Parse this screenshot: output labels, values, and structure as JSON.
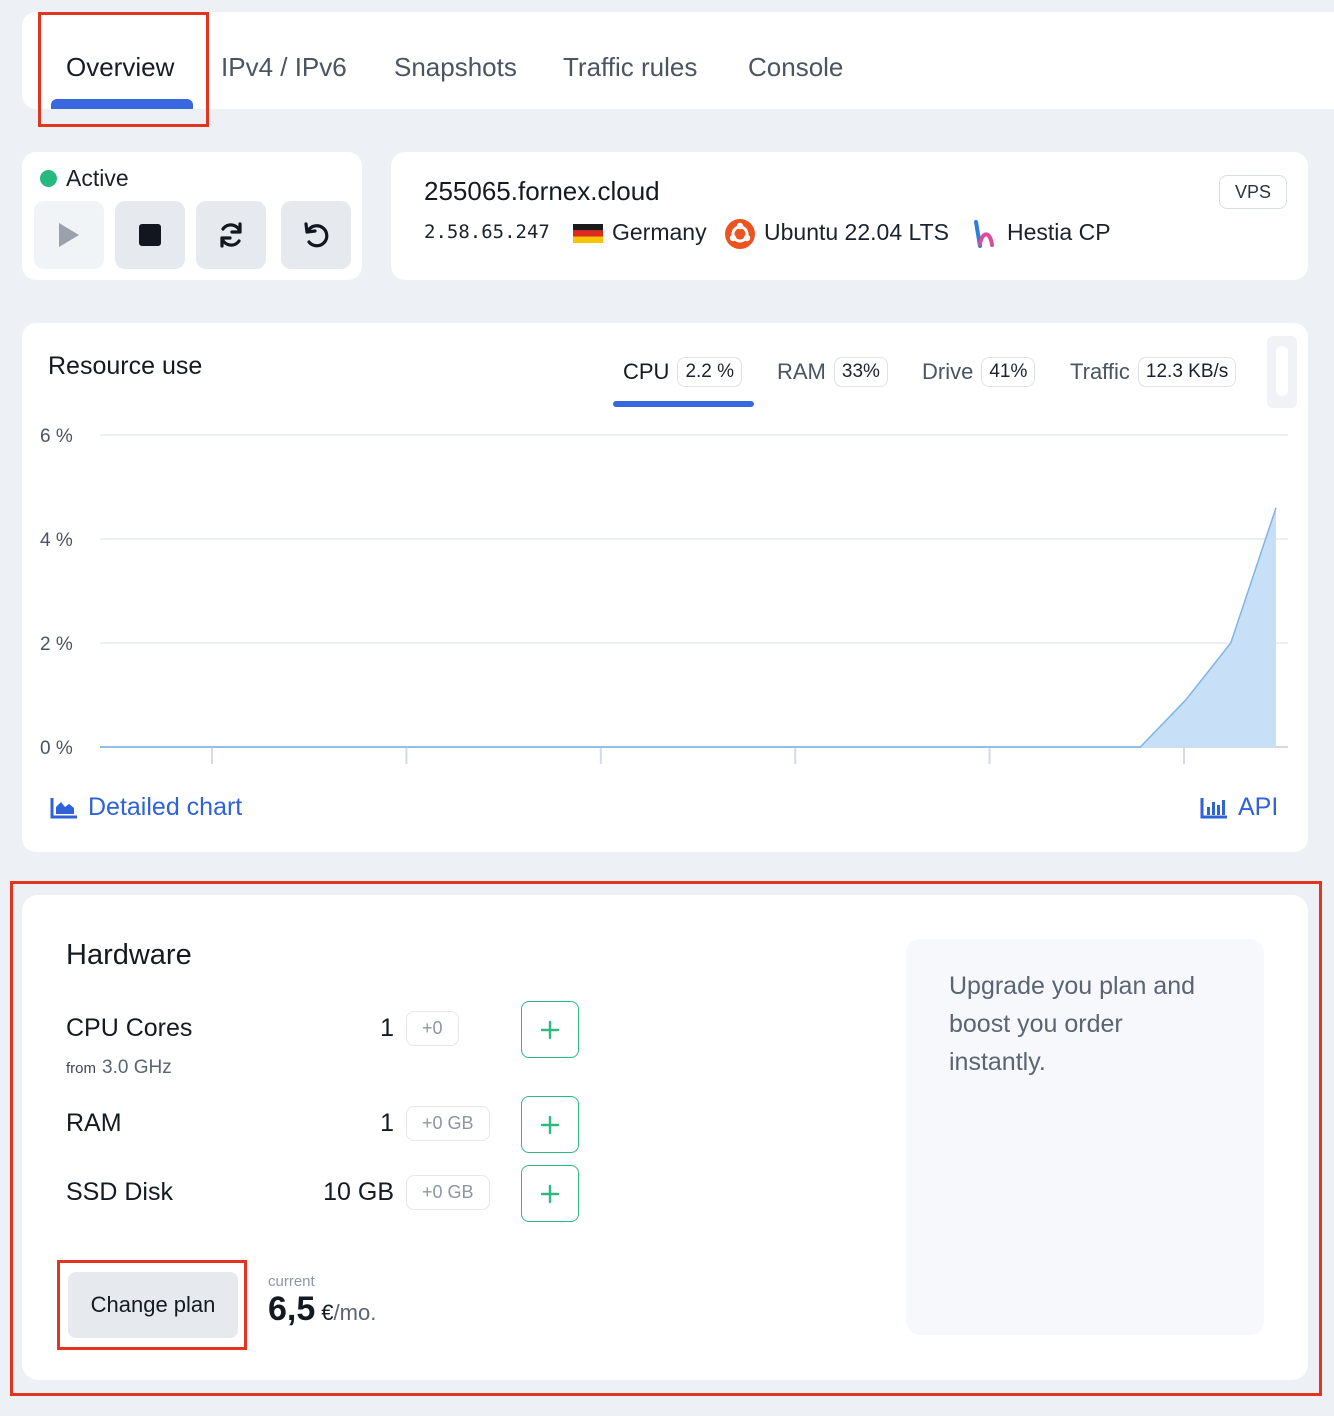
{
  "tabs": [
    {
      "label": "Overview",
      "active": true
    },
    {
      "label": "IPv4 / IPv6",
      "active": false
    },
    {
      "label": "Snapshots",
      "active": false
    },
    {
      "label": "Traffic rules",
      "active": false
    },
    {
      "label": "Console",
      "active": false
    }
  ],
  "status": {
    "label": "Active",
    "color": "#28b981",
    "controls": [
      "play-icon",
      "stop-icon",
      "refresh-icon",
      "reinstall-icon"
    ]
  },
  "server": {
    "hostname": "255065.fornex.cloud",
    "type_badge": "VPS",
    "ip": "2.58.65.247",
    "country": "Germany",
    "os": "Ubuntu 22.04 LTS",
    "panel": "Hestia CP"
  },
  "resources": {
    "title": "Resource use",
    "tabs": [
      {
        "label": "CPU",
        "value": "2.2 %",
        "active": true
      },
      {
        "label": "RAM",
        "value": "33%",
        "active": false
      },
      {
        "label": "Drive",
        "value": "41%",
        "active": false
      },
      {
        "label": "Traffic",
        "value": "12.3 KB/s",
        "active": false
      }
    ],
    "detailed_chart_label": "Detailed chart",
    "api_label": "API"
  },
  "chart_data": {
    "type": "area",
    "ylabel": "",
    "xlabel": "",
    "y_ticks": [
      "0 %",
      "2 %",
      "4 %",
      "6 %"
    ],
    "ylim": [
      0,
      6
    ],
    "grid": true,
    "color": "#c8e0f7",
    "stroke": "#7fb5e6",
    "x": [
      0,
      1,
      2,
      3,
      4,
      5,
      6,
      7,
      8,
      9,
      10,
      11,
      12,
      13,
      14,
      15,
      16,
      17,
      18,
      19,
      20,
      21,
      22,
      23,
      24,
      25,
      26
    ],
    "values": [
      0,
      0,
      0,
      0,
      0,
      0,
      0,
      0,
      0,
      0,
      0,
      0,
      0,
      0,
      0,
      0,
      0,
      0,
      0,
      0,
      0,
      0,
      0,
      0,
      0.9,
      2.0,
      4.6
    ]
  },
  "hardware": {
    "title": "Hardware",
    "rows": [
      {
        "label": "CPU Cores",
        "value": "1",
        "delta": "+0",
        "sub_prefix": "from",
        "sub_value": "3.0 GHz"
      },
      {
        "label": "RAM",
        "value": "1",
        "delta": "+0 GB"
      },
      {
        "label": "SSD Disk",
        "value": "10 GB",
        "delta": "+0 GB"
      }
    ],
    "change_plan_label": "Change plan",
    "price_caption": "current",
    "price_amount": "6,5",
    "price_currency": "€",
    "price_period": "/mo.",
    "upgrade_text": "Upgrade you plan and boost you order instantly."
  },
  "colors": {
    "accent": "#3867e0",
    "link": "#2f62d6",
    "success": "#2fb981",
    "highlight": "#e2341e"
  }
}
